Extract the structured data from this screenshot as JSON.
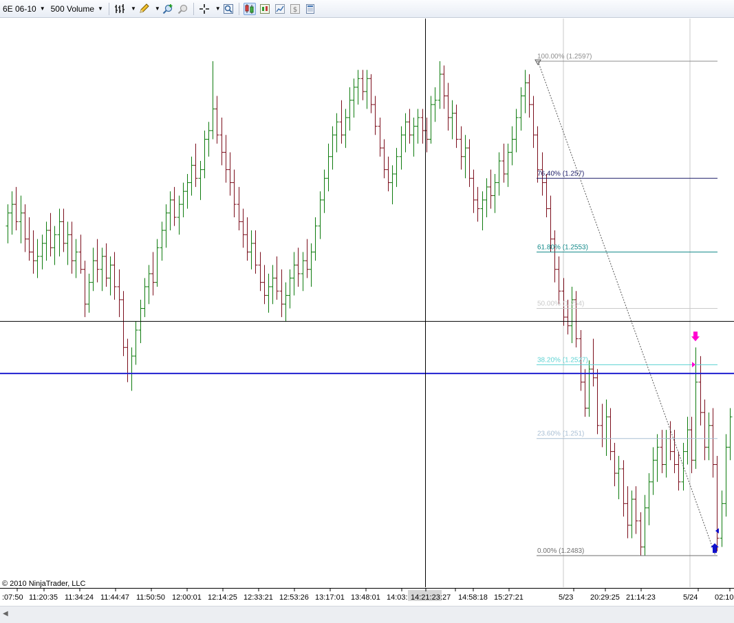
{
  "toolbar": {
    "instrument": "6E 06-10",
    "period": "500 Volume",
    "icons": [
      "bar-type-icon",
      "pencil-draw-icon",
      "zoom-in-icon",
      "zoom-out-icon",
      "crosshair-icon",
      "magnifier-icon",
      "chart-style-icon",
      "candlestick-icon",
      "line-chart-icon",
      "dollar-icon",
      "data-box-icon"
    ]
  },
  "copyright": "© 2010 NinjaTrader, LLC",
  "colors": {
    "up_bar": "#0c7a0c",
    "down_bar": "#7a0c1a",
    "crosshair": "#000000",
    "horizontal_line": "#1f1fd0",
    "fib_100": "#8e8e8e",
    "fib_764": "#1a1a66",
    "fib_618": "#138a8a",
    "fib_50": "#c9c9c9",
    "fib_382": "#5fd3d3",
    "fib_236": "#a9bfd4",
    "fib_0": "#6e6e6e",
    "arrow_down": "#ff00d0",
    "arrow_up": "#1010cc"
  },
  "chart_data": {
    "type": "bar",
    "instrument": "6E 06-10",
    "bar_period": "500 Volume",
    "x_axis_labels": [
      ":07:50",
      "11:20:35",
      "11:34:24",
      "11:44:47",
      "11:50:50",
      "12:00:01",
      "12:14:25",
      "12:33:21",
      "12:53:26",
      "13:17:01",
      "13:48:01",
      "14:03:",
      "14:21:23",
      ":27",
      "14:58:18",
      "15:27:21",
      "5/23",
      "20:29:25",
      "21:14:23",
      "5/24",
      "02:10"
    ],
    "crosshair_time": "14:21:23",
    "fibonacci_retracement": [
      {
        "label": "100.00% (1.2597)",
        "price": 1.2597
      },
      {
        "label": "76.40% (1.257)",
        "price": 1.257
      },
      {
        "label": "61.80% (1.2553)",
        "price": 1.2553
      },
      {
        "label": "50.00% (1.254)",
        "price": 1.254
      },
      {
        "label": "38.20% (1.2527)",
        "price": 1.2527
      },
      {
        "label": "23.60% (1.251)",
        "price": 1.251
      },
      {
        "label": "0.00% (1.2483)",
        "price": 1.2483
      }
    ],
    "horizontal_line_price": 1.2525,
    "crosshair_price": 1.2537,
    "markers": [
      {
        "type": "sell-arrow",
        "price": 1.2531
      },
      {
        "type": "buy-arrow",
        "price": 1.2483
      }
    ],
    "ohlc": [
      {
        "o": 1.2559,
        "h": 1.2564,
        "l": 1.2555,
        "c": 1.2562
      },
      {
        "o": 1.2562,
        "h": 1.2567,
        "l": 1.2557,
        "c": 1.2564
      },
      {
        "o": 1.2564,
        "h": 1.2568,
        "l": 1.2558,
        "c": 1.256
      },
      {
        "o": 1.256,
        "h": 1.2566,
        "l": 1.2555,
        "c": 1.2562
      },
      {
        "o": 1.2562,
        "h": 1.2564,
        "l": 1.2553,
        "c": 1.2556
      },
      {
        "o": 1.2556,
        "h": 1.2561,
        "l": 1.2551,
        "c": 1.2553
      },
      {
        "o": 1.2553,
        "h": 1.2558,
        "l": 1.2548,
        "c": 1.2551
      },
      {
        "o": 1.2551,
        "h": 1.2556,
        "l": 1.2547,
        "c": 1.2552
      },
      {
        "o": 1.2552,
        "h": 1.2557,
        "l": 1.2549,
        "c": 1.2555
      },
      {
        "o": 1.2555,
        "h": 1.256,
        "l": 1.2551,
        "c": 1.2558
      },
      {
        "o": 1.2558,
        "h": 1.2562,
        "l": 1.2552,
        "c": 1.2554
      },
      {
        "o": 1.2554,
        "h": 1.2559,
        "l": 1.255,
        "c": 1.2557
      },
      {
        "o": 1.2557,
        "h": 1.2563,
        "l": 1.2552,
        "c": 1.256
      },
      {
        "o": 1.256,
        "h": 1.2563,
        "l": 1.2553,
        "c": 1.2555
      },
      {
        "o": 1.2555,
        "h": 1.256,
        "l": 1.255,
        "c": 1.2557
      },
      {
        "o": 1.2557,
        "h": 1.256,
        "l": 1.2548,
        "c": 1.2551
      },
      {
        "o": 1.2551,
        "h": 1.2556,
        "l": 1.2547,
        "c": 1.2553
      },
      {
        "o": 1.2553,
        "h": 1.2557,
        "l": 1.2548,
        "c": 1.2549
      },
      {
        "o": 1.2549,
        "h": 1.2551,
        "l": 1.2538,
        "c": 1.2541
      },
      {
        "o": 1.2541,
        "h": 1.2548,
        "l": 1.2539,
        "c": 1.2546
      },
      {
        "o": 1.2546,
        "h": 1.2554,
        "l": 1.2544,
        "c": 1.2551
      },
      {
        "o": 1.2551,
        "h": 1.2556,
        "l": 1.2546,
        "c": 1.2549
      },
      {
        "o": 1.2549,
        "h": 1.2554,
        "l": 1.2544,
        "c": 1.2552
      },
      {
        "o": 1.2552,
        "h": 1.2555,
        "l": 1.2545,
        "c": 1.2547
      },
      {
        "o": 1.2547,
        "h": 1.2552,
        "l": 1.2543,
        "c": 1.255
      },
      {
        "o": 1.255,
        "h": 1.2553,
        "l": 1.2542,
        "c": 1.2545
      },
      {
        "o": 1.2545,
        "h": 1.2549,
        "l": 1.2538,
        "c": 1.2542
      },
      {
        "o": 1.2542,
        "h": 1.2544,
        "l": 1.2529,
        "c": 1.2531
      },
      {
        "o": 1.2531,
        "h": 1.2533,
        "l": 1.2523,
        "c": 1.2525
      },
      {
        "o": 1.2525,
        "h": 1.2531,
        "l": 1.2521,
        "c": 1.2529
      },
      {
        "o": 1.2529,
        "h": 1.2537,
        "l": 1.2527,
        "c": 1.2535
      },
      {
        "o": 1.2535,
        "h": 1.2542,
        "l": 1.2532,
        "c": 1.254
      },
      {
        "o": 1.254,
        "h": 1.2547,
        "l": 1.2538,
        "c": 1.2545
      },
      {
        "o": 1.2545,
        "h": 1.255,
        "l": 1.2541,
        "c": 1.2548
      },
      {
        "o": 1.2548,
        "h": 1.2553,
        "l": 1.2543,
        "c": 1.2546
      },
      {
        "o": 1.2546,
        "h": 1.2556,
        "l": 1.2545,
        "c": 1.2554
      },
      {
        "o": 1.2554,
        "h": 1.256,
        "l": 1.2551,
        "c": 1.2558
      },
      {
        "o": 1.2558,
        "h": 1.2564,
        "l": 1.2554,
        "c": 1.2562
      },
      {
        "o": 1.2562,
        "h": 1.2567,
        "l": 1.2558,
        "c": 1.2565
      },
      {
        "o": 1.2565,
        "h": 1.2568,
        "l": 1.2559,
        "c": 1.2561
      },
      {
        "o": 1.2561,
        "h": 1.2566,
        "l": 1.2557,
        "c": 1.2564
      },
      {
        "o": 1.2564,
        "h": 1.2569,
        "l": 1.2561,
        "c": 1.2567
      },
      {
        "o": 1.2567,
        "h": 1.2571,
        "l": 1.2563,
        "c": 1.2569
      },
      {
        "o": 1.2569,
        "h": 1.2575,
        "l": 1.2566,
        "c": 1.2573
      },
      {
        "o": 1.2573,
        "h": 1.2578,
        "l": 1.2568,
        "c": 1.257
      },
      {
        "o": 1.257,
        "h": 1.2574,
        "l": 1.2565,
        "c": 1.2572
      },
      {
        "o": 1.2572,
        "h": 1.2581,
        "l": 1.257,
        "c": 1.2579
      },
      {
        "o": 1.2579,
        "h": 1.2583,
        "l": 1.2575,
        "c": 1.2581
      },
      {
        "o": 1.2581,
        "h": 1.2597,
        "l": 1.2579,
        "c": 1.2586
      },
      {
        "o": 1.2586,
        "h": 1.2589,
        "l": 1.2578,
        "c": 1.258
      },
      {
        "o": 1.258,
        "h": 1.2584,
        "l": 1.2573,
        "c": 1.2576
      },
      {
        "o": 1.2576,
        "h": 1.258,
        "l": 1.2569,
        "c": 1.2572
      },
      {
        "o": 1.2572,
        "h": 1.2576,
        "l": 1.2566,
        "c": 1.2569
      },
      {
        "o": 1.2569,
        "h": 1.2572,
        "l": 1.2561,
        "c": 1.2564
      },
      {
        "o": 1.2564,
        "h": 1.2568,
        "l": 1.2558,
        "c": 1.256
      },
      {
        "o": 1.256,
        "h": 1.2563,
        "l": 1.2554,
        "c": 1.2557
      },
      {
        "o": 1.2557,
        "h": 1.2561,
        "l": 1.2551,
        "c": 1.2553
      },
      {
        "o": 1.2553,
        "h": 1.2558,
        "l": 1.2549,
        "c": 1.2555
      },
      {
        "o": 1.2555,
        "h": 1.2558,
        "l": 1.2548,
        "c": 1.255
      },
      {
        "o": 1.255,
        "h": 1.2553,
        "l": 1.2544,
        "c": 1.2546
      },
      {
        "o": 1.2546,
        "h": 1.255,
        "l": 1.2541,
        "c": 1.2543
      },
      {
        "o": 1.2543,
        "h": 1.2548,
        "l": 1.2539,
        "c": 1.2545
      },
      {
        "o": 1.2545,
        "h": 1.255,
        "l": 1.2541,
        "c": 1.2547
      },
      {
        "o": 1.2547,
        "h": 1.2552,
        "l": 1.2542,
        "c": 1.2544
      },
      {
        "o": 1.2544,
        "h": 1.2549,
        "l": 1.2538,
        "c": 1.2541
      },
      {
        "o": 1.2541,
        "h": 1.2546,
        "l": 1.2537,
        "c": 1.2543
      },
      {
        "o": 1.2543,
        "h": 1.2549,
        "l": 1.254,
        "c": 1.2547
      },
      {
        "o": 1.2547,
        "h": 1.2553,
        "l": 1.2543,
        "c": 1.255
      },
      {
        "o": 1.255,
        "h": 1.2554,
        "l": 1.2545,
        "c": 1.2548
      },
      {
        "o": 1.2548,
        "h": 1.2553,
        "l": 1.2544,
        "c": 1.2551
      },
      {
        "o": 1.2551,
        "h": 1.2556,
        "l": 1.2547,
        "c": 1.2549
      },
      {
        "o": 1.2549,
        "h": 1.2555,
        "l": 1.2545,
        "c": 1.2553
      },
      {
        "o": 1.2553,
        "h": 1.2561,
        "l": 1.2551,
        "c": 1.2559
      },
      {
        "o": 1.2559,
        "h": 1.2567,
        "l": 1.2556,
        "c": 1.2565
      },
      {
        "o": 1.2565,
        "h": 1.2572,
        "l": 1.2562,
        "c": 1.257
      },
      {
        "o": 1.257,
        "h": 1.2578,
        "l": 1.2567,
        "c": 1.2575
      },
      {
        "o": 1.2575,
        "h": 1.2582,
        "l": 1.2572,
        "c": 1.258
      },
      {
        "o": 1.258,
        "h": 1.2585,
        "l": 1.2576,
        "c": 1.2583
      },
      {
        "o": 1.2583,
        "h": 1.2588,
        "l": 1.2578,
        "c": 1.258
      },
      {
        "o": 1.258,
        "h": 1.2586,
        "l": 1.2577,
        "c": 1.2584
      },
      {
        "o": 1.2584,
        "h": 1.2591,
        "l": 1.2581,
        "c": 1.2588
      },
      {
        "o": 1.2588,
        "h": 1.2593,
        "l": 1.2584,
        "c": 1.2591
      },
      {
        "o": 1.2591,
        "h": 1.2595,
        "l": 1.2587,
        "c": 1.2593
      },
      {
        "o": 1.2593,
        "h": 1.2595,
        "l": 1.2588,
        "c": 1.259
      },
      {
        "o": 1.259,
        "h": 1.2595,
        "l": 1.2586,
        "c": 1.2593
      },
      {
        "o": 1.2593,
        "h": 1.2594,
        "l": 1.2585,
        "c": 1.2587
      },
      {
        "o": 1.2587,
        "h": 1.2589,
        "l": 1.258,
        "c": 1.2582
      },
      {
        "o": 1.2582,
        "h": 1.2584,
        "l": 1.2575,
        "c": 1.2577
      },
      {
        "o": 1.2577,
        "h": 1.2579,
        "l": 1.257,
        "c": 1.2572
      },
      {
        "o": 1.2572,
        "h": 1.2575,
        "l": 1.2567,
        "c": 1.2569
      },
      {
        "o": 1.2569,
        "h": 1.2573,
        "l": 1.2564,
        "c": 1.2571
      },
      {
        "o": 1.2571,
        "h": 1.2577,
        "l": 1.2568,
        "c": 1.2575
      },
      {
        "o": 1.2575,
        "h": 1.2582,
        "l": 1.2572,
        "c": 1.258
      },
      {
        "o": 1.258,
        "h": 1.2585,
        "l": 1.2576,
        "c": 1.2583
      },
      {
        "o": 1.2583,
        "h": 1.2586,
        "l": 1.2578,
        "c": 1.258
      },
      {
        "o": 1.258,
        "h": 1.2584,
        "l": 1.2575,
        "c": 1.2582
      },
      {
        "o": 1.2582,
        "h": 1.2586,
        "l": 1.2578,
        "c": 1.2584
      },
      {
        "o": 1.2584,
        "h": 1.2586,
        "l": 1.2578,
        "c": 1.2581
      },
      {
        "o": 1.2581,
        "h": 1.2584,
        "l": 1.2576,
        "c": 1.2579
      },
      {
        "o": 1.2579,
        "h": 1.2589,
        "l": 1.2578,
        "c": 1.2587
      },
      {
        "o": 1.2587,
        "h": 1.2591,
        "l": 1.2583,
        "c": 1.2588
      },
      {
        "o": 1.2588,
        "h": 1.2597,
        "l": 1.2586,
        "c": 1.2594
      },
      {
        "o": 1.2594,
        "h": 1.2596,
        "l": 1.2586,
        "c": 1.2589
      },
      {
        "o": 1.2589,
        "h": 1.2592,
        "l": 1.2581,
        "c": 1.2584
      },
      {
        "o": 1.2584,
        "h": 1.2588,
        "l": 1.2579,
        "c": 1.2585
      },
      {
        "o": 1.2585,
        "h": 1.2587,
        "l": 1.2577,
        "c": 1.2579
      },
      {
        "o": 1.2579,
        "h": 1.2582,
        "l": 1.2572,
        "c": 1.2575
      },
      {
        "o": 1.2575,
        "h": 1.258,
        "l": 1.257,
        "c": 1.2577
      },
      {
        "o": 1.2577,
        "h": 1.2579,
        "l": 1.2568,
        "c": 1.257
      },
      {
        "o": 1.257,
        "h": 1.2572,
        "l": 1.2562,
        "c": 1.2565
      },
      {
        "o": 1.2565,
        "h": 1.2568,
        "l": 1.256,
        "c": 1.2563
      },
      {
        "o": 1.2563,
        "h": 1.2567,
        "l": 1.2558,
        "c": 1.2565
      },
      {
        "o": 1.2565,
        "h": 1.257,
        "l": 1.2561,
        "c": 1.2568
      },
      {
        "o": 1.2568,
        "h": 1.2572,
        "l": 1.2563,
        "c": 1.2566
      },
      {
        "o": 1.2566,
        "h": 1.2571,
        "l": 1.2562,
        "c": 1.2569
      },
      {
        "o": 1.2569,
        "h": 1.2576,
        "l": 1.2566,
        "c": 1.2574
      },
      {
        "o": 1.2574,
        "h": 1.2578,
        "l": 1.2569,
        "c": 1.2571
      },
      {
        "o": 1.2571,
        "h": 1.2578,
        "l": 1.2568,
        "c": 1.2576
      },
      {
        "o": 1.2576,
        "h": 1.2582,
        "l": 1.2573,
        "c": 1.2579
      },
      {
        "o": 1.2579,
        "h": 1.2586,
        "l": 1.2576,
        "c": 1.2584
      },
      {
        "o": 1.2584,
        "h": 1.2591,
        "l": 1.2581,
        "c": 1.2589
      },
      {
        "o": 1.2589,
        "h": 1.2595,
        "l": 1.2585,
        "c": 1.2592
      },
      {
        "o": 1.2592,
        "h": 1.2594,
        "l": 1.2584,
        "c": 1.2587
      },
      {
        "o": 1.2587,
        "h": 1.2589,
        "l": 1.2577,
        "c": 1.258
      },
      {
        "o": 1.258,
        "h": 1.2582,
        "l": 1.2569,
        "c": 1.2572
      },
      {
        "o": 1.2572,
        "h": 1.2576,
        "l": 1.2566,
        "c": 1.2569
      },
      {
        "o": 1.2569,
        "h": 1.2571,
        "l": 1.2561,
        "c": 1.2563
      },
      {
        "o": 1.2563,
        "h": 1.2566,
        "l": 1.2553,
        "c": 1.2556
      },
      {
        "o": 1.2556,
        "h": 1.2558,
        "l": 1.2546,
        "c": 1.2549
      },
      {
        "o": 1.2549,
        "h": 1.2552,
        "l": 1.2541,
        "c": 1.2544
      },
      {
        "o": 1.2544,
        "h": 1.2547,
        "l": 1.2536,
        "c": 1.2538
      },
      {
        "o": 1.2538,
        "h": 1.2542,
        "l": 1.2534,
        "c": 1.2536
      },
      {
        "o": 1.2536,
        "h": 1.2545,
        "l": 1.2532,
        "c": 1.2542
      },
      {
        "o": 1.2542,
        "h": 1.2544,
        "l": 1.2531,
        "c": 1.2533
      },
      {
        "o": 1.2533,
        "h": 1.2535,
        "l": 1.2521,
        "c": 1.2523
      },
      {
        "o": 1.2523,
        "h": 1.2526,
        "l": 1.2515,
        "c": 1.2517
      },
      {
        "o": 1.2517,
        "h": 1.2528,
        "l": 1.2515,
        "c": 1.2526
      },
      {
        "o": 1.2526,
        "h": 1.2533,
        "l": 1.2522,
        "c": 1.2524
      },
      {
        "o": 1.2524,
        "h": 1.2526,
        "l": 1.2511,
        "c": 1.2513
      },
      {
        "o": 1.2513,
        "h": 1.2518,
        "l": 1.2508,
        "c": 1.251
      },
      {
        "o": 1.251,
        "h": 1.2519,
        "l": 1.2506,
        "c": 1.2515
      },
      {
        "o": 1.2515,
        "h": 1.2517,
        "l": 1.2505,
        "c": 1.2507
      },
      {
        "o": 1.2507,
        "h": 1.2509,
        "l": 1.2499,
        "c": 1.2502
      },
      {
        "o": 1.2502,
        "h": 1.2506,
        "l": 1.2496,
        "c": 1.2503
      },
      {
        "o": 1.2503,
        "h": 1.2505,
        "l": 1.2492,
        "c": 1.2495
      },
      {
        "o": 1.2495,
        "h": 1.2499,
        "l": 1.2487,
        "c": 1.249
      },
      {
        "o": 1.249,
        "h": 1.2498,
        "l": 1.2487,
        "c": 1.2496
      },
      {
        "o": 1.2496,
        "h": 1.2499,
        "l": 1.2488,
        "c": 1.2491
      },
      {
        "o": 1.2491,
        "h": 1.2493,
        "l": 1.2483,
        "c": 1.2485
      },
      {
        "o": 1.2485,
        "h": 1.2497,
        "l": 1.2483,
        "c": 1.2494
      },
      {
        "o": 1.2494,
        "h": 1.2502,
        "l": 1.249,
        "c": 1.25
      },
      {
        "o": 1.25,
        "h": 1.2508,
        "l": 1.2497,
        "c": 1.2505
      },
      {
        "o": 1.2505,
        "h": 1.2511,
        "l": 1.25,
        "c": 1.2508
      },
      {
        "o": 1.2508,
        "h": 1.2512,
        "l": 1.2502,
        "c": 1.2504
      },
      {
        "o": 1.2504,
        "h": 1.2512,
        "l": 1.2501,
        "c": 1.251
      },
      {
        "o": 1.251,
        "h": 1.2514,
        "l": 1.2505,
        "c": 1.2507
      },
      {
        "o": 1.2507,
        "h": 1.2512,
        "l": 1.2502,
        "c": 1.2504
      },
      {
        "o": 1.2504,
        "h": 1.2507,
        "l": 1.2498,
        "c": 1.25
      },
      {
        "o": 1.25,
        "h": 1.2509,
        "l": 1.2498,
        "c": 1.2507
      },
      {
        "o": 1.2507,
        "h": 1.2515,
        "l": 1.2504,
        "c": 1.2512
      },
      {
        "o": 1.2512,
        "h": 1.2515,
        "l": 1.2502,
        "c": 1.2505
      },
      {
        "o": 1.2505,
        "h": 1.2531,
        "l": 1.2503,
        "c": 1.2523
      },
      {
        "o": 1.2523,
        "h": 1.2529,
        "l": 1.2513,
        "c": 1.2516
      },
      {
        "o": 1.2516,
        "h": 1.2519,
        "l": 1.2505,
        "c": 1.2508
      },
      {
        "o": 1.2508,
        "h": 1.2516,
        "l": 1.2505,
        "c": 1.2513
      },
      {
        "o": 1.2513,
        "h": 1.2517,
        "l": 1.2501,
        "c": 1.2504
      },
      {
        "o": 1.2504,
        "h": 1.2506,
        "l": 1.2484,
        "c": 1.2487
      },
      {
        "o": 1.2487,
        "h": 1.2498,
        "l": 1.2485,
        "c": 1.2495
      },
      {
        "o": 1.2495,
        "h": 1.2511,
        "l": 1.2492,
        "c": 1.2508
      },
      {
        "o": 1.2508,
        "h": 1.2517,
        "l": 1.2505,
        "c": 1.2515
      }
    ]
  }
}
